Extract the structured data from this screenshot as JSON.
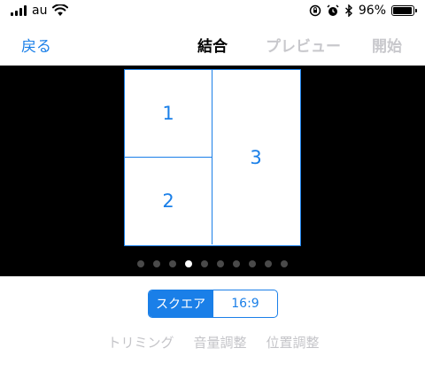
{
  "status_bar": {
    "carrier": "au",
    "battery_percent": "96%",
    "battery_level": 0.96,
    "icons": [
      "signal-bars-icon",
      "wifi-icon",
      "orientation-lock-icon",
      "alarm-icon",
      "bluetooth-icon",
      "battery-icon"
    ]
  },
  "nav": {
    "back_label": "戻る",
    "title": "結合",
    "preview_label": "プレビュー",
    "start_label": "開始"
  },
  "layout_cells": [
    "1",
    "2",
    "3"
  ],
  "page_dots": {
    "count": 10,
    "active_index": 3
  },
  "aspect": {
    "options": [
      "スクエア",
      "16:9"
    ],
    "selected": "スクエア"
  },
  "tools": [
    "トリミング",
    "音量調整",
    "位置調整"
  ],
  "colors": {
    "accent": "#1a7fe8",
    "disabled": "#c8c8cc",
    "stage_background": "#000000"
  }
}
